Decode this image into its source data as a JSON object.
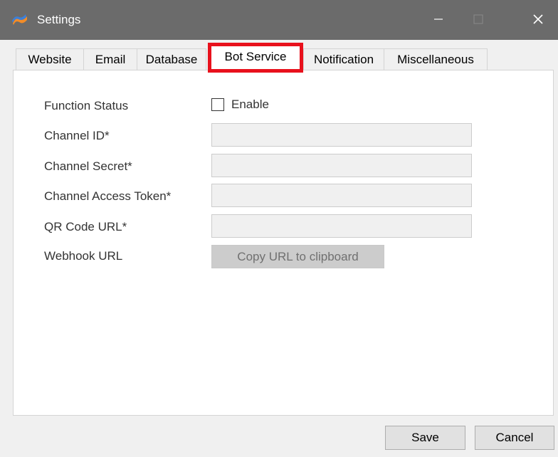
{
  "window": {
    "title": "Settings",
    "app_icon": "app-logo-icon",
    "controls": {
      "minimize_icon": "minimize-icon",
      "maximize_icon": "maximize-icon",
      "close_icon": "close-icon"
    }
  },
  "tabs": [
    {
      "label": "Website",
      "selected": false
    },
    {
      "label": "Email",
      "selected": false
    },
    {
      "label": "Database",
      "selected": false
    },
    {
      "label": "Bot Service",
      "selected": true,
      "highlighted": true
    },
    {
      "label": "Notification",
      "selected": false
    },
    {
      "label": "Miscellaneous",
      "selected": false
    }
  ],
  "form": {
    "function_status": {
      "label": "Function Status",
      "checkbox_label": "Enable",
      "checked": false
    },
    "channel_id": {
      "label": "Channel ID*",
      "value": ""
    },
    "channel_secret": {
      "label": "Channel Secret*",
      "value": ""
    },
    "channel_access_token": {
      "label": "Channel Access Token*",
      "value": ""
    },
    "qr_code_url": {
      "label": "QR Code URL*",
      "value": ""
    },
    "webhook_url": {
      "label": "Webhook URL",
      "button_label": "Copy URL to clipboard"
    }
  },
  "buttons": {
    "save": "Save",
    "cancel": "Cancel"
  },
  "colors": {
    "titlebar": "#6b6b6b",
    "highlight": "#e8111c",
    "panel": "#ffffff",
    "window_bg": "#f0f0f0",
    "disabled_field": "#f0f0f0"
  }
}
